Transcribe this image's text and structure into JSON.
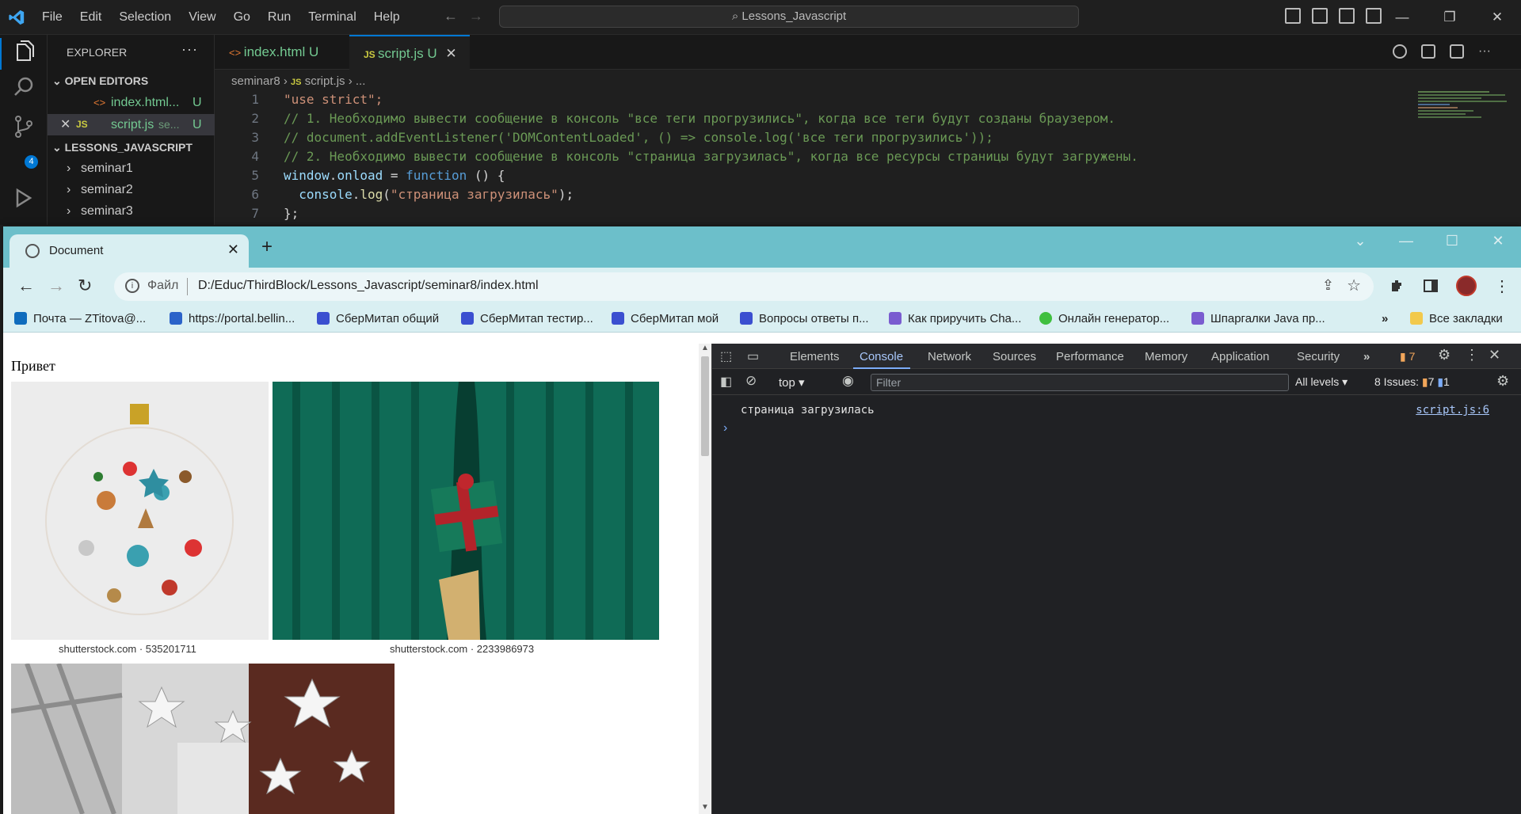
{
  "vscode": {
    "menu": [
      "File",
      "Edit",
      "Selection",
      "View",
      "Go",
      "Run",
      "Terminal",
      "Help"
    ],
    "search_text": "Lessons_Javascript",
    "explorer_title": "EXPLORER",
    "open_editors_label": "OPEN EDITORS",
    "open_editors": [
      {
        "name": "index.html...",
        "status": "U"
      },
      {
        "name": "script.js",
        "desc": "se...",
        "status": "U"
      }
    ],
    "workspace_label": "LESSONS_JAVASCRIPT",
    "folders": [
      "seminar1",
      "seminar2",
      "seminar3"
    ],
    "scm_badge": "4",
    "tabs": [
      {
        "name": "index.html",
        "status": "U"
      },
      {
        "name": "script.js",
        "status": "U"
      }
    ],
    "breadcrumb": [
      "seminar8",
      "script.js",
      "..."
    ],
    "line_numbers": [
      "1",
      "2",
      "3",
      "4",
      "5",
      "6",
      "7"
    ],
    "code": {
      "l1": "\"use strict\";",
      "l2": "// 1. Необходимо вывести сообщение в консоль \"все теги прогрузились\", когда все теги будут созданы браузером.",
      "l3": "// document.addEventListener('DOMContentLoaded', () => console.log('все теги прогрузились'));",
      "l4": "// 2. Необходимо вывести сообщение в консоль \"страница загрузилась\", когда все ресурсы страницы будут загружены.",
      "l5_a": "window",
      "l5_b": ".",
      "l5_c": "onload",
      "l5_d": " = ",
      "l5_e": "function",
      "l5_f": " () {",
      "l6_a": "  console",
      "l6_b": ".",
      "l6_c": "log",
      "l6_d": "(",
      "l6_e": "\"страница загрузилась\"",
      "l6_f": ");",
      "l7": "};"
    }
  },
  "browser": {
    "tab_title": "Document",
    "omnibox_scheme": "Файл",
    "url": "D:/Educ/ThirdBlock/Lessons_Javascript/seminar8/index.html",
    "bookmarks": [
      "Почта — ZTitova@...",
      "https://portal.bellin...",
      "СберМитап общий",
      "СберМитап тестир...",
      "СберМитап мой",
      "Вопросы ответы п...",
      "Как приручить Cha...",
      "Онлайн генератор...",
      "Шпаргалки Java пр..."
    ],
    "bookmarks_more": "»",
    "all_bookmarks": "Все закладки",
    "page": {
      "heading": "Привет",
      "caption1": "shutterstock.com · 535201711",
      "caption2": "shutterstock.com · 2233986973"
    }
  },
  "devtools": {
    "tabs": [
      "Elements",
      "Console",
      "Network",
      "Sources",
      "Performance",
      "Memory",
      "Application",
      "Security"
    ],
    "more": "»",
    "warn_count": "7",
    "context": "top",
    "filter_placeholder": "Filter",
    "levels": "All levels",
    "issues_label": "8 Issues:",
    "issues_warn": "7",
    "issues_info": "1",
    "log_message": "страница загрузилась",
    "log_source": "script.js:6",
    "prompt": "›"
  },
  "colors": {
    "accent": "#0078d4",
    "chrome_frame": "#6cbfca",
    "chrome_toolbar": "#d9eff2"
  }
}
